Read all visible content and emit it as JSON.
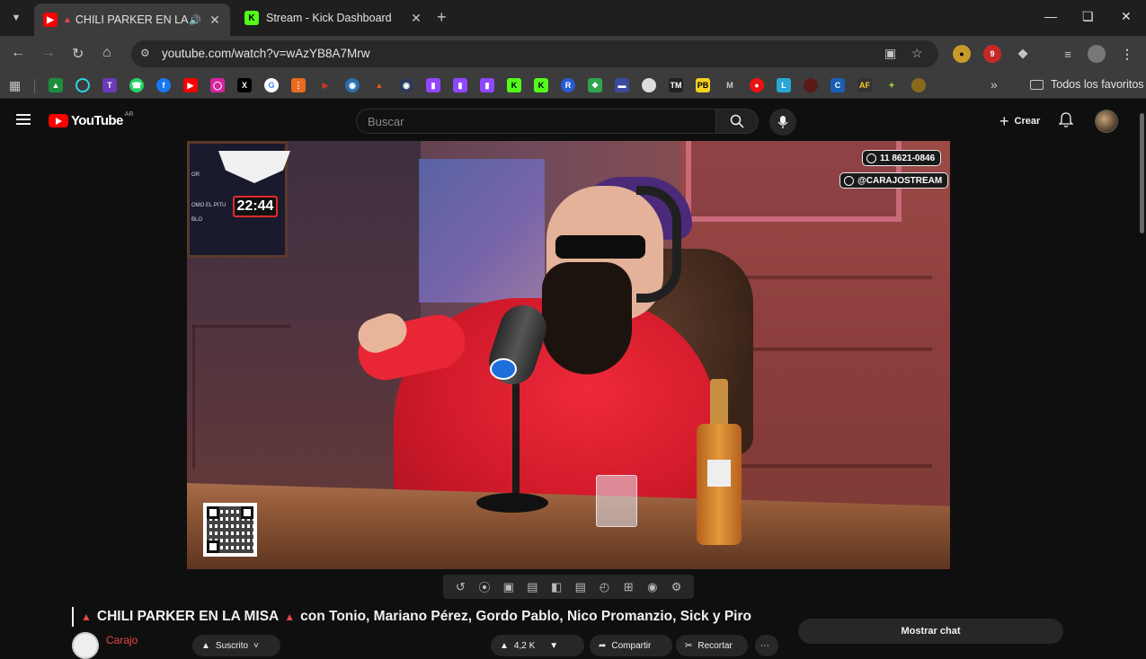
{
  "browser": {
    "tabs": [
      {
        "title": "CHILI PARKER EN LA MISA",
        "favicon": "youtube-icon",
        "active": true,
        "audio": true
      },
      {
        "title": "Stream - Kick Dashboard",
        "favicon": "kick-icon",
        "active": false
      }
    ],
    "url": "youtube.com/watch?v=wAzYB8A7Mrw",
    "bookmarks_folder": "Todos los favoritos"
  },
  "youtube": {
    "logo_text": "YouTube",
    "region": "AR",
    "search_placeholder": "Buscar",
    "create_label": "Crear"
  },
  "video": {
    "clock": "22:44",
    "phone_tag": "11 8621-0846",
    "handle_tag": "@CARAJOSTREAM",
    "sign_lines": [
      "OR",
      "OMO EL PITU",
      "BLO"
    ],
    "title_part1": "CHILI PARKER EN LA MISA",
    "title_part2": "con Tonio, Mariano Pérez, Gordo Pablo, Nico Promanzio, Sick y Piro",
    "channel": "Carajo",
    "subscribe_label": "Suscrito",
    "likes": "4,2 K",
    "share_label": "Compartir",
    "clip_label": "Recortar"
  },
  "chat": {
    "show_chat_label": "Mostrar chat"
  },
  "colors": {
    "youtube_red": "#ff0000",
    "kick_green": "#53fc18",
    "hoodie_red": "#d11a2a",
    "channel_red": "#e64848"
  }
}
